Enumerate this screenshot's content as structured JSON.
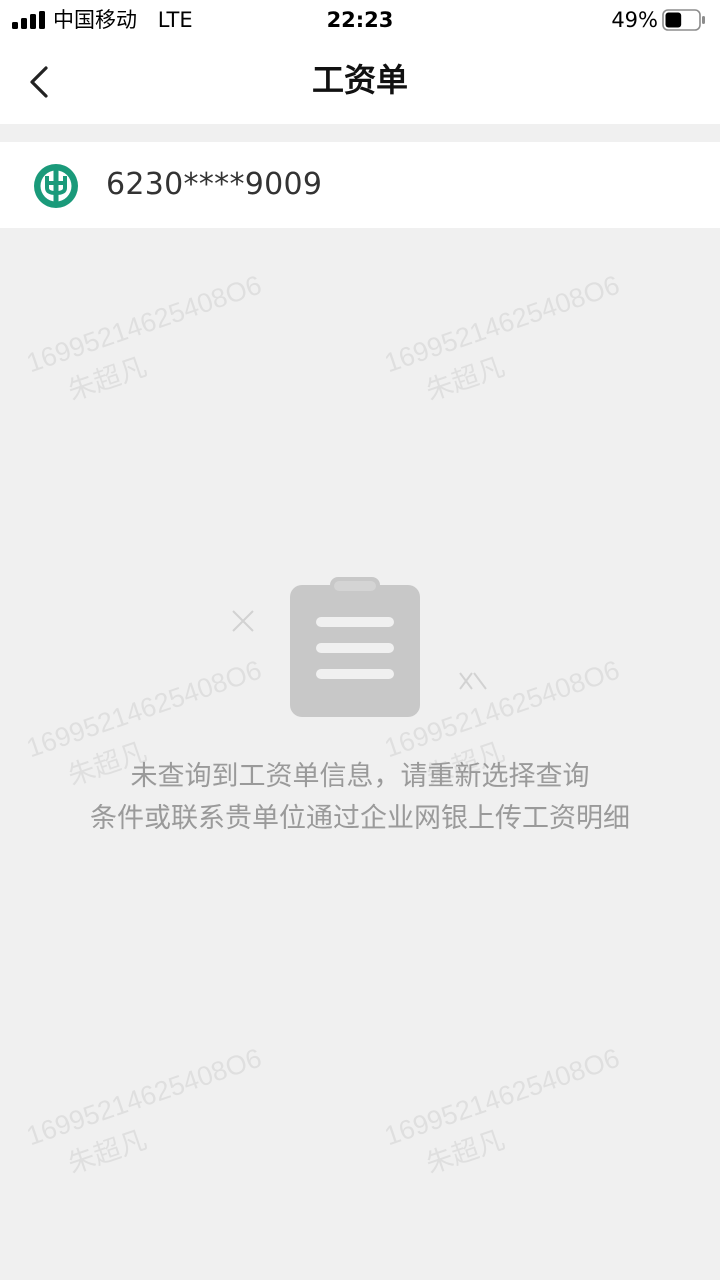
{
  "status_bar": {
    "carrier": "中国移动",
    "network": "LTE",
    "time": "22:23",
    "battery_percent": "49%",
    "battery_level": 0.49
  },
  "nav": {
    "title": "工资单",
    "back_icon": "chevron-left-icon"
  },
  "account": {
    "bank_icon": "abc-bank-logo-icon",
    "number": "6230****9009",
    "brand_color": "#1a9a7a"
  },
  "watermark": {
    "number": "16995214625408O6",
    "name": "朱超凡"
  },
  "empty_state": {
    "icon": "clipboard-icon",
    "line1": "未查询到工资单信息，请重新选择查询",
    "line2": "条件或联系贵单位通过企业网银上传工资明细"
  }
}
